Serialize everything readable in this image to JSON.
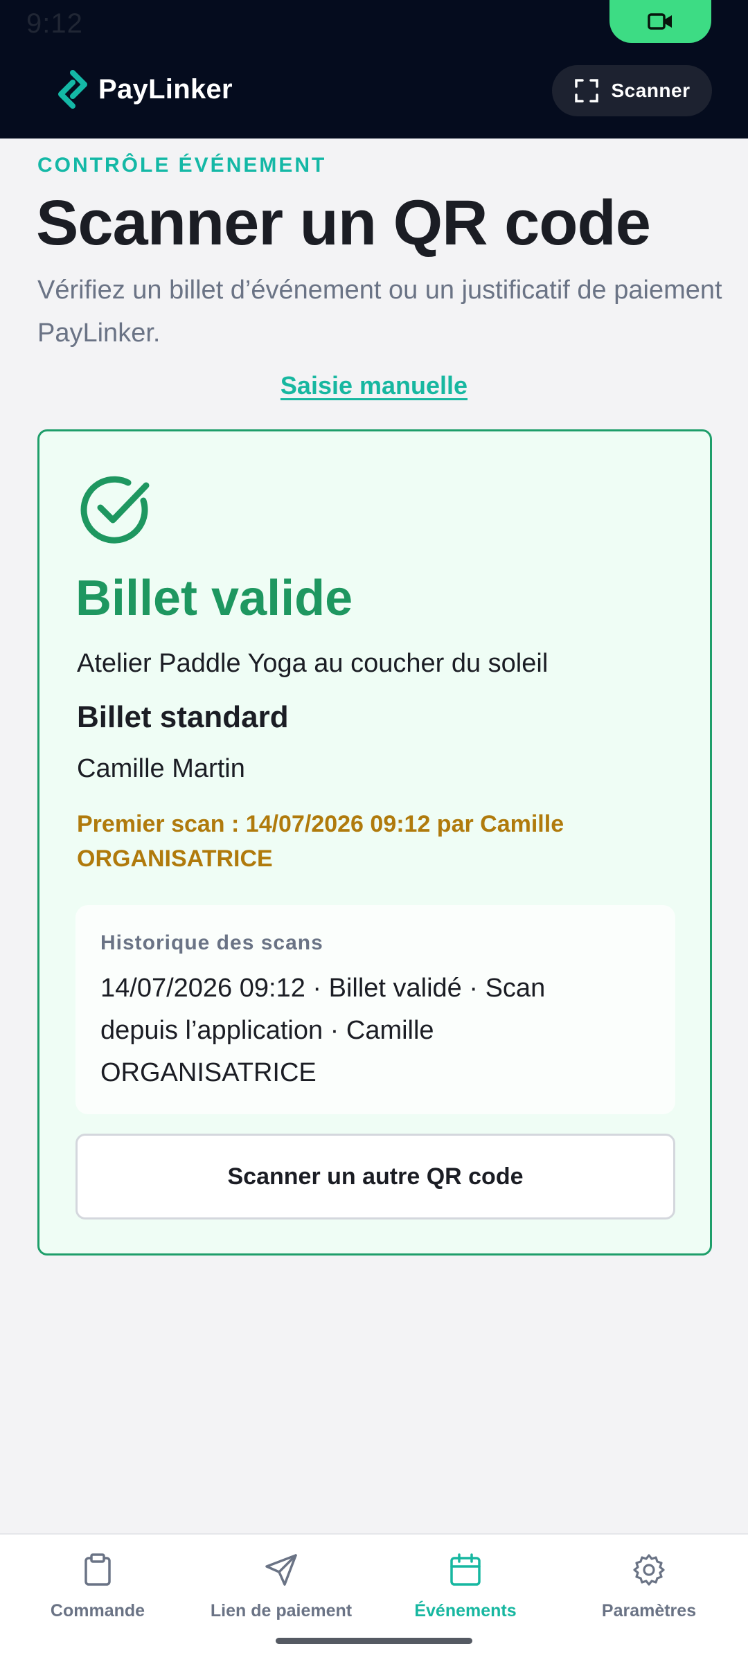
{
  "status_bar": {
    "time": "9:12"
  },
  "header": {
    "brand": "PayLinker",
    "scanner_label": "Scanner"
  },
  "page": {
    "eyebrow": "CONTRÔLE ÉVÉNEMENT",
    "title": "Scanner un QR code",
    "subtitle": "Vérifiez un billet d’événement ou un justificatif de paiement PayLinker.",
    "manual_link": "Saisie manuelle"
  },
  "result": {
    "title": "Billet valide",
    "event_name": "Atelier Paddle Yoga au coucher du soleil",
    "ticket_type": "Billet standard",
    "holder": "Camille Martin",
    "first_scan": "Premier scan : 14/07/2026 09:12 par Camille ORGANISATRICE",
    "history_label": "Historique des scans",
    "history_entry": "14/07/2026 09:12 · Billet validé · Scan depuis l’application · Camille ORGANISATRICE",
    "scan_again_label": "Scanner un autre QR code"
  },
  "nav": {
    "items": [
      {
        "label": "Commande",
        "icon": "clipboard-icon"
      },
      {
        "label": "Lien de paiement",
        "icon": "send-icon"
      },
      {
        "label": "Événements",
        "icon": "calendar-icon",
        "active": true
      },
      {
        "label": "Paramètres",
        "icon": "gear-icon"
      }
    ]
  },
  "colors": {
    "header_bg": "#050c1e",
    "accent": "#17b7a0",
    "success": "#1e9760",
    "warning": "#b07a0c",
    "camera_pill": "#3ddc84"
  }
}
